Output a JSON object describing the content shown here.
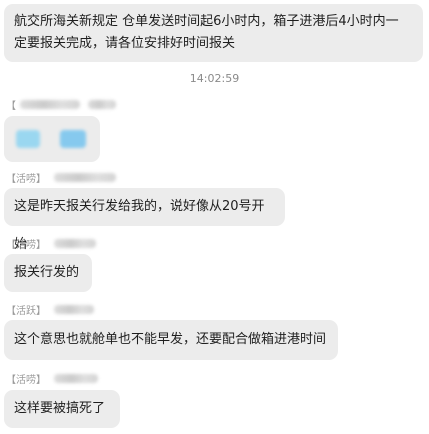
{
  "messages": [
    {
      "text_line1": "航交所海关新规定 仓单发送时间起6小时内，箱子进港后4小时内一",
      "text_line2": "定要报关完成，请各位安排好时间报关"
    }
  ],
  "timestamp": "14:02:59",
  "senders": {
    "s1": {
      "tag": "【"
    },
    "s2": {
      "tag": "【活唠】"
    },
    "s3": {
      "tag": "【活唠】"
    },
    "s4": {
      "tag": "【活跃】"
    },
    "s5": {
      "tag": "【活唠】"
    }
  },
  "chat": {
    "m2": "这是昨天报关行发给我的，说好像从20号开始",
    "m3": "报关行发的",
    "m4": "这个意思也就舱单也不能早发，还要配合做箱进港时间",
    "m5": "这样要被搞死了"
  },
  "colors": {
    "bubble": "#ececec",
    "sticker": "#8fd3f0"
  }
}
